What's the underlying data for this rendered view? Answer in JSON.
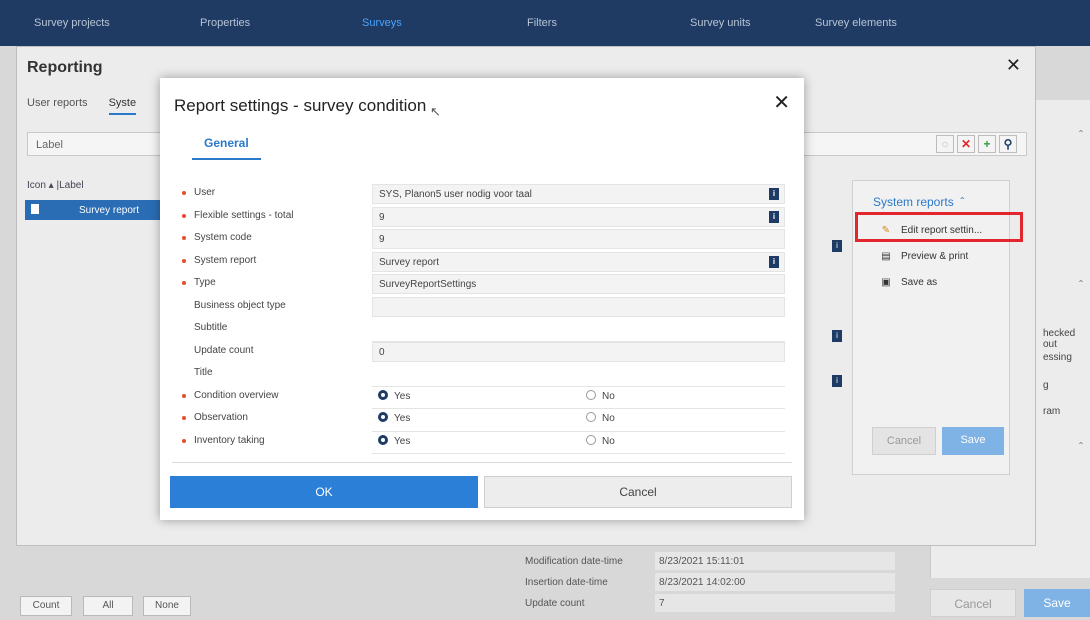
{
  "topnav": {
    "tabs": [
      "Survey projects",
      "Properties",
      "Surveys",
      "Filters",
      "Survey units",
      "Survey elements"
    ],
    "active": "Surveys"
  },
  "reporting": {
    "title": "Reporting",
    "tabs": [
      "User reports",
      "Syste"
    ],
    "label_field": "Label",
    "list_header": "Icon  ▴ |Label",
    "list_row": "Survey report",
    "system_reports": {
      "title": "System reports",
      "items": [
        "Edit report settin...",
        "Preview & print",
        "Save as"
      ],
      "cancel": "Cancel",
      "save": "Save"
    },
    "bottom_fields": [
      {
        "label": "Modification date-time",
        "value": "8/23/2021 15:11:01"
      },
      {
        "label": "Insertion date-time",
        "value": "8/23/2021 14:02:00"
      },
      {
        "label": "Update count",
        "value": "7"
      }
    ],
    "bottom_buttons": [
      "Count",
      "All",
      "None"
    ],
    "far_buttons": [
      "Cancel",
      "Save"
    ],
    "right_fragments": [
      "hecked out",
      "essing",
      "g",
      "ram"
    ]
  },
  "modal": {
    "title": "Report settings - survey condition",
    "tab": "General",
    "fields": [
      {
        "label": "User",
        "value": "SYS, Planon5 user nodig voor taal",
        "required": true,
        "info": true
      },
      {
        "label": "Flexible settings - total",
        "value": "9",
        "required": true,
        "info": true
      },
      {
        "label": "System code",
        "value": "9",
        "required": true,
        "info": false
      },
      {
        "label": "System report",
        "value": "Survey report",
        "required": true,
        "info": true
      },
      {
        "label": "Type",
        "value": "SurveyReportSettings",
        "required": true,
        "info": false
      },
      {
        "label": "Business object type",
        "value": "",
        "required": false,
        "info": false
      },
      {
        "label": "Subtitle",
        "value": "",
        "required": false,
        "info": false
      },
      {
        "label": "Update count",
        "value": "0",
        "required": false,
        "info": false
      },
      {
        "label": "Title",
        "value": "",
        "required": false,
        "info": false
      }
    ],
    "radios": [
      {
        "label": "Condition overview",
        "yes": "Yes",
        "no": "No"
      },
      {
        "label": "Observation",
        "yes": "Yes",
        "no": "No"
      },
      {
        "label": "Inventory taking",
        "yes": "Yes",
        "no": "No"
      }
    ],
    "ok": "OK",
    "cancel": "Cancel"
  },
  "colors": {
    "nav": "#1f3b63",
    "accent": "#2b79c9",
    "ok_button": "#2c7fd6",
    "required_dot": "#e64e2d",
    "highlight": "#e3262e"
  }
}
